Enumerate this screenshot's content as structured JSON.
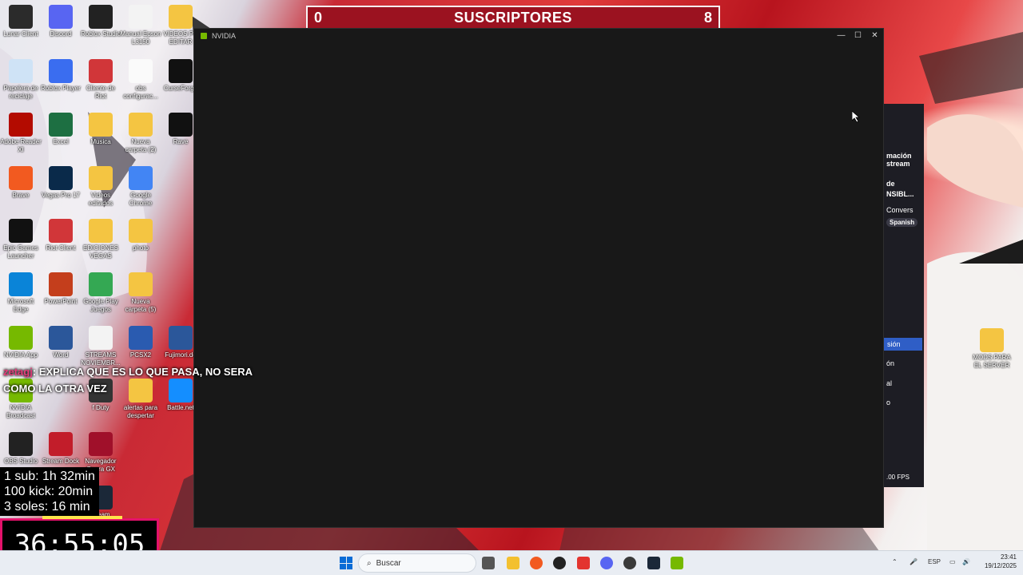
{
  "subs_bar": {
    "left_count": "0",
    "title": "SUSCRIPTORES",
    "right_count": "8"
  },
  "nvidia_window": {
    "title": "NVIDIA",
    "controls": [
      "—",
      "☐",
      "✕"
    ]
  },
  "desktop_icons": [
    {
      "label": "Lunar Client",
      "icon": "lunar-icon"
    },
    {
      "label": "Discord",
      "icon": "discord-icon"
    },
    {
      "label": "Roblox Studio",
      "icon": "roblox-studio-icon"
    },
    {
      "label": "Manual Epson L3150",
      "icon": "document-icon"
    },
    {
      "label": "VIDEOS PC EDITAR",
      "icon": "folder-icon"
    },
    {
      "label": "Papelera de reciclaje",
      "icon": "recycle-bin-icon"
    },
    {
      "label": "Roblox Player",
      "icon": "roblox-player-icon"
    },
    {
      "label": "Cliente de Riot",
      "icon": "riot-icon"
    },
    {
      "label": "obs configurac...",
      "icon": "file-icon"
    },
    {
      "label": "CurseForge",
      "icon": "curseforge-icon"
    },
    {
      "label": "Adobe Reader XI",
      "icon": "adobe-icon"
    },
    {
      "label": "Excel",
      "icon": "excel-icon"
    },
    {
      "label": "Musica",
      "icon": "folder-icon"
    },
    {
      "label": "Nueva carpeta (2)",
      "icon": "folder-icon"
    },
    {
      "label": "Rave",
      "icon": "rave-icon"
    },
    {
      "label": "Brave",
      "icon": "brave-icon"
    },
    {
      "label": "Vegas Pro 17",
      "icon": "vegas-icon"
    },
    {
      "label": "Videos editados",
      "icon": "folder-icon"
    },
    {
      "label": "Google Chrome",
      "icon": "chrome-icon"
    },
    {
      "label": "Epic Games Launcher",
      "icon": "epic-icon"
    },
    {
      "label": "Riot Client",
      "icon": "riot-icon"
    },
    {
      "label": "EDICIONES VEGAS",
      "icon": "folder-icon"
    },
    {
      "label": "photo",
      "icon": "folder-icon"
    },
    {
      "label": "Microsoft Edge",
      "icon": "edge-icon"
    },
    {
      "label": "PowerPoint",
      "icon": "powerpoint-icon"
    },
    {
      "label": "Google Play Juegos",
      "icon": "google-play-icon"
    },
    {
      "label": "Nueva carpeta (5)",
      "icon": "folder-icon"
    },
    {
      "label": "NVIDIA App",
      "icon": "nvidia-icon"
    },
    {
      "label": "Word",
      "icon": "word-icon"
    },
    {
      "label": "STREAMS NOVIEMBR...",
      "icon": "document-icon"
    },
    {
      "label": "PCSX2",
      "icon": "pcsx2-icon"
    },
    {
      "label": "Fujimori.do",
      "icon": "word-icon"
    },
    {
      "label": "NVIDIA Broadcast",
      "icon": "nvidia-icon"
    },
    {
      "label": "f Duty",
      "icon": "cod-icon"
    },
    {
      "label": "alertas para despertar",
      "icon": "folder-icon"
    },
    {
      "label": "Battle.net",
      "icon": "battlenet-icon"
    },
    {
      "label": "OBS Studio",
      "icon": "obs-icon"
    },
    {
      "label": "Stream Dock",
      "icon": "stream-dock-icon"
    },
    {
      "label": "Navegador Opera GX",
      "icon": "opera-icon"
    },
    {
      "label": "Steam",
      "icon": "steam-icon"
    },
    {
      "label": "MODS PARA EL SERVER",
      "icon": "folder-icon"
    }
  ],
  "obs_panel": {
    "lines": [
      "mación",
      "stream",
      "de",
      "NSIBL...",
      "Convers",
      "Spanish",
      "sión",
      "ón",
      "al",
      "o",
      ".00 FPS"
    ]
  },
  "chat": {
    "user": "zetagj",
    "message": ": EXPLICA QUE ES LO QUE PASA, NO SERA COMO LA OTRA VEZ"
  },
  "goals": [
    "1 sub: 1h 32min",
    "100 kick: 20min",
    "3 soles: 16 min"
  ],
  "timer": {
    "value": "36:55:05"
  },
  "taskbar": {
    "search_placeholder": "Buscar",
    "language": "ESP",
    "time": "23:41",
    "date": "19/12/2025"
  },
  "colors": {
    "accent": "#e4126b",
    "sub_bar": "#9b1220",
    "nvidia_green": "#76b900"
  }
}
